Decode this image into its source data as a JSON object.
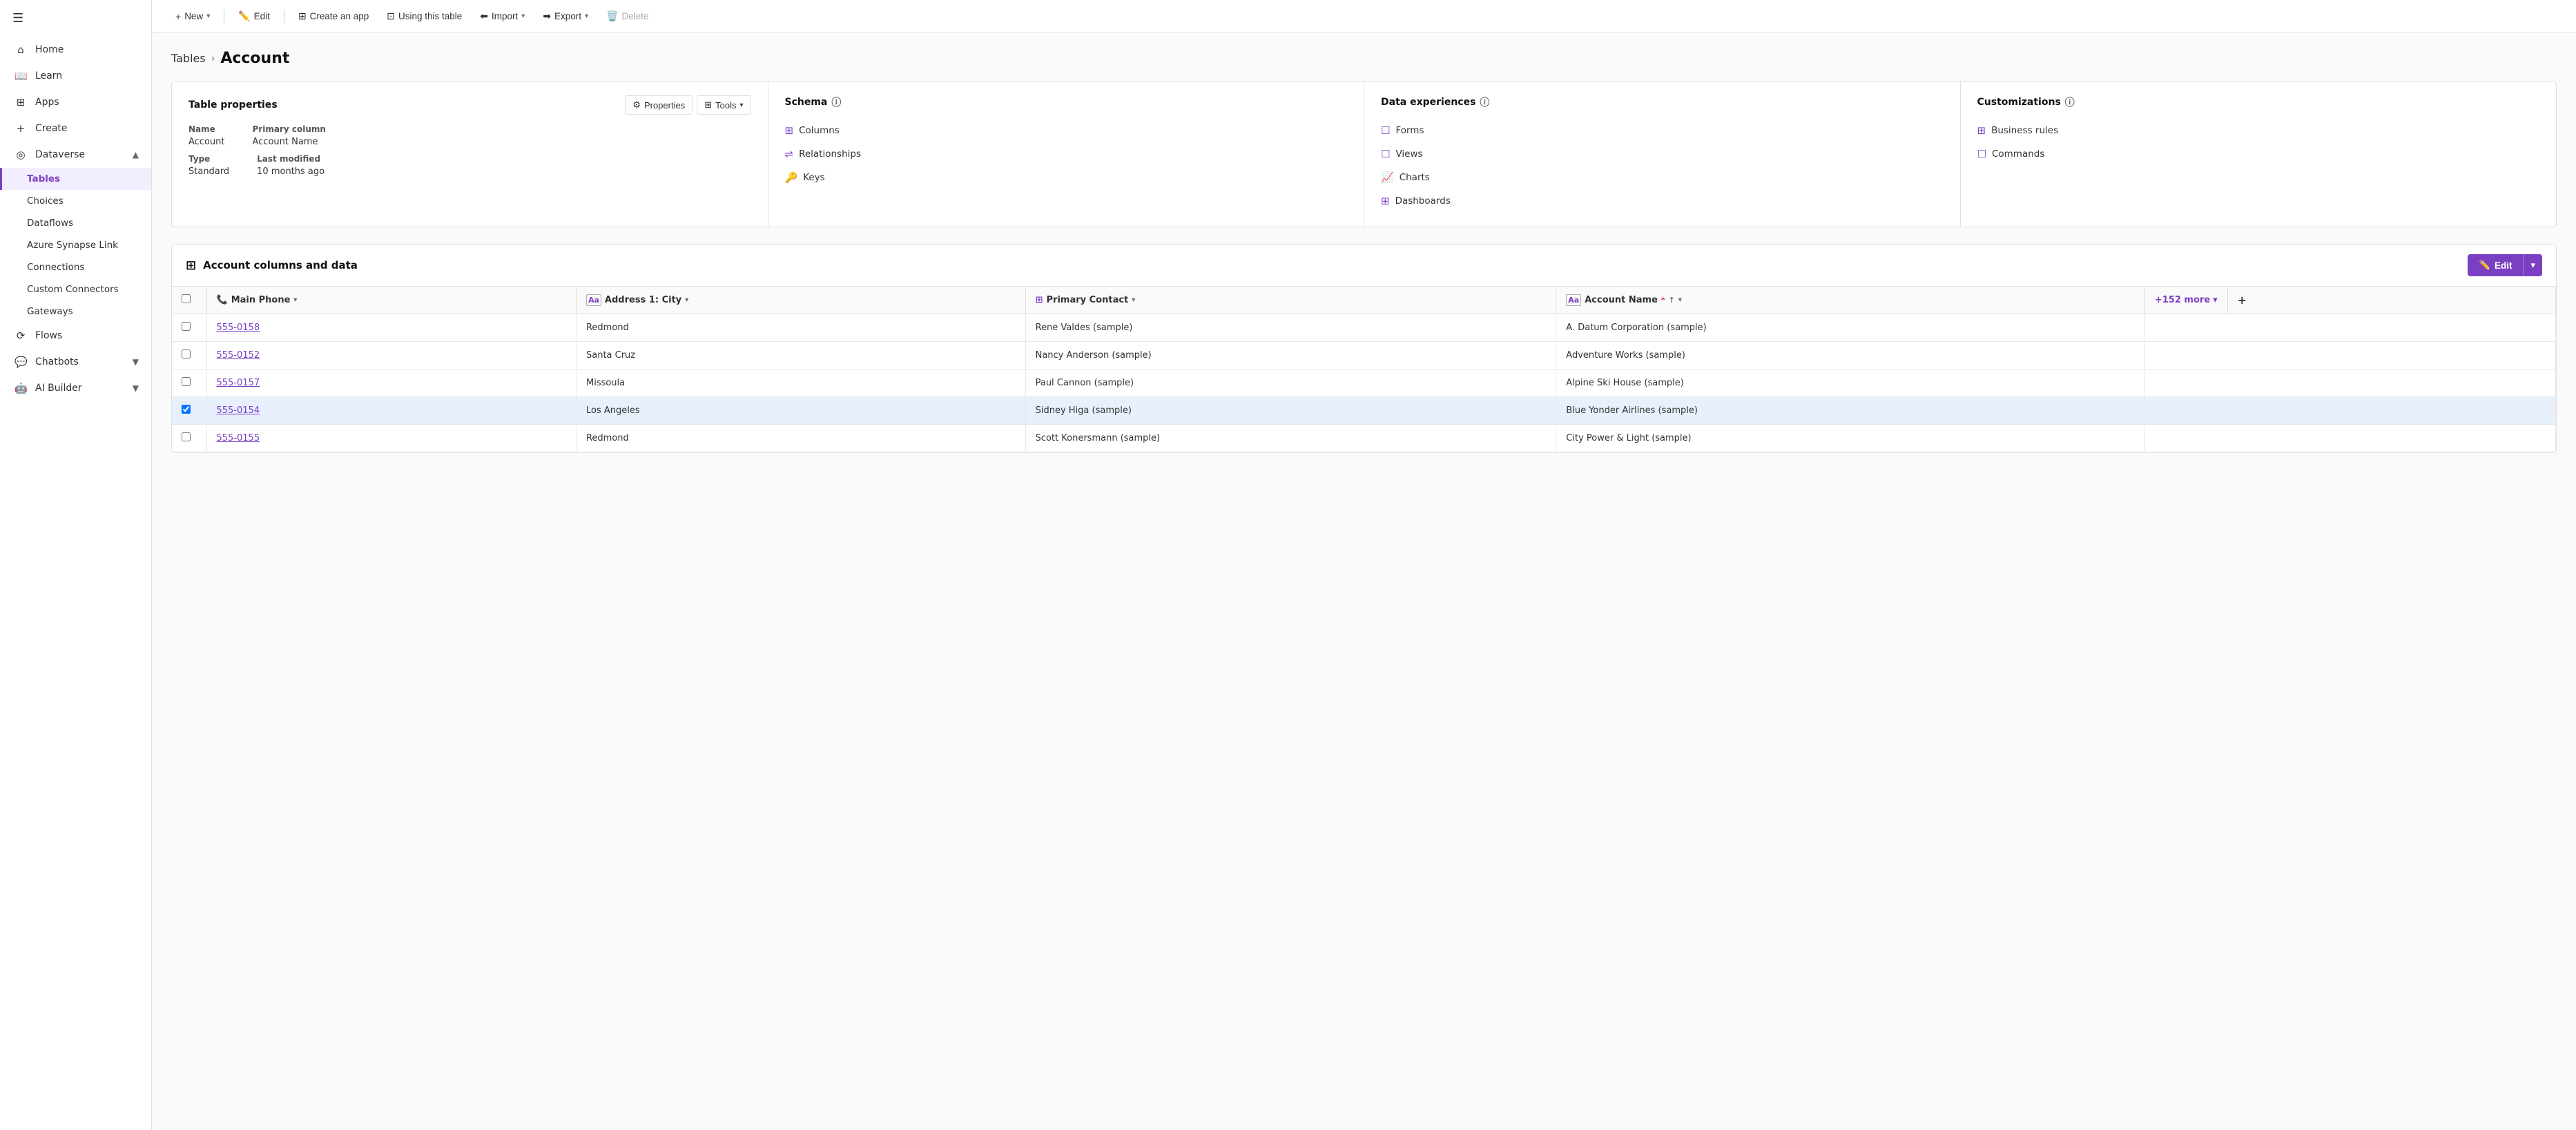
{
  "sidebar": {
    "hamburger_icon": "☰",
    "items": [
      {
        "id": "home",
        "label": "Home",
        "icon": "⌂",
        "active": false
      },
      {
        "id": "learn",
        "label": "Learn",
        "icon": "☰",
        "active": false
      },
      {
        "id": "apps",
        "label": "Apps",
        "icon": "⊞",
        "active": false
      },
      {
        "id": "create",
        "label": "Create",
        "icon": "+",
        "active": false
      },
      {
        "id": "dataverse",
        "label": "Dataverse",
        "icon": "◎",
        "active": false,
        "expanded": true,
        "has_chevron": true
      },
      {
        "id": "tables",
        "label": "Tables",
        "active": true
      },
      {
        "id": "choices",
        "label": "Choices",
        "active": false
      },
      {
        "id": "dataflows",
        "label": "Dataflows",
        "active": false
      },
      {
        "id": "azure-synapse",
        "label": "Azure Synapse Link",
        "active": false
      },
      {
        "id": "connections",
        "label": "Connections",
        "active": false
      },
      {
        "id": "custom-connectors",
        "label": "Custom Connectors",
        "active": false
      },
      {
        "id": "gateways",
        "label": "Gateways",
        "active": false
      },
      {
        "id": "flows",
        "label": "Flows",
        "icon": "⟳",
        "active": false
      },
      {
        "id": "chatbots",
        "label": "Chatbots",
        "icon": "💬",
        "active": false,
        "has_chevron": true
      },
      {
        "id": "ai-builder",
        "label": "AI Builder",
        "active": false,
        "has_chevron": true
      }
    ]
  },
  "toolbar": {
    "new_label": "New",
    "edit_label": "Edit",
    "create_app_label": "Create an app",
    "using_this_table_label": "Using this table",
    "import_label": "Import",
    "export_label": "Export",
    "delete_label": "Delete"
  },
  "breadcrumb": {
    "tables_label": "Tables",
    "separator": "›",
    "current": "Account"
  },
  "table_properties": {
    "section_title": "Table properties",
    "properties_btn": "Properties",
    "tools_btn": "Tools",
    "name_label": "Name",
    "name_value": "Account",
    "primary_col_label": "Primary column",
    "primary_col_value": "Account Name",
    "type_label": "Type",
    "type_value": "Standard",
    "last_modified_label": "Last modified",
    "last_modified_value": "10 months ago"
  },
  "schema": {
    "title": "Schema",
    "info_icon": "ⓘ",
    "links": [
      {
        "id": "columns",
        "label": "Columns",
        "icon": "⊞"
      },
      {
        "id": "relationships",
        "label": "Relationships",
        "icon": "⇌"
      },
      {
        "id": "keys",
        "label": "Keys",
        "icon": "🔑"
      }
    ]
  },
  "data_experiences": {
    "title": "Data experiences",
    "info_icon": "ⓘ",
    "links": [
      {
        "id": "forms",
        "label": "Forms",
        "icon": "☐"
      },
      {
        "id": "views",
        "label": "Views",
        "icon": "☐"
      },
      {
        "id": "charts",
        "label": "Charts",
        "icon": "📈"
      },
      {
        "id": "dashboards",
        "label": "Dashboards",
        "icon": "⊞"
      }
    ]
  },
  "customizations": {
    "title": "Customizations",
    "info_icon": "ⓘ",
    "links": [
      {
        "id": "business-rules",
        "label": "Business rules",
        "icon": "⊞"
      },
      {
        "id": "commands",
        "label": "Commands",
        "icon": "☐"
      }
    ]
  },
  "data_section": {
    "title": "Account columns and data",
    "edit_label": "Edit",
    "columns": [
      {
        "id": "checkbox",
        "label": ""
      },
      {
        "id": "main-phone",
        "label": "Main Phone",
        "icon": "📞",
        "has_dropdown": true
      },
      {
        "id": "address-city",
        "label": "Address 1: City",
        "icon": "Aa",
        "has_dropdown": true
      },
      {
        "id": "primary-contact",
        "label": "Primary Contact",
        "icon": "⊞",
        "has_dropdown": true
      },
      {
        "id": "account-name",
        "label": "Account Name",
        "icon": "Aa",
        "required": true,
        "has_sort": true,
        "has_dropdown": true
      }
    ],
    "more_cols_label": "+152 more",
    "rows": [
      {
        "id": "row1",
        "main_phone": "555-0158",
        "address_city": "Redmond",
        "primary_contact": "Rene Valdes (sample)",
        "account_name": "A. Datum Corporation (sample)",
        "selected": false,
        "phone_link": true
      },
      {
        "id": "row2",
        "main_phone": "555-0152",
        "address_city": "Santa Cruz",
        "primary_contact": "Nancy Anderson (sample)",
        "account_name": "Adventure Works (sample)",
        "selected": false,
        "phone_link": true
      },
      {
        "id": "row3",
        "main_phone": "555-0157",
        "address_city": "Missoula",
        "primary_contact": "Paul Cannon (sample)",
        "account_name": "Alpine Ski House (sample)",
        "selected": false,
        "phone_link": true,
        "underline_phone": true
      },
      {
        "id": "row4",
        "main_phone": "555-0154",
        "address_city": "Los Angeles",
        "primary_contact": "Sidney Higa (sample)",
        "account_name": "Blue Yonder Airlines (sample)",
        "selected": true,
        "phone_link": true
      },
      {
        "id": "row5",
        "main_phone": "555-0155",
        "address_city": "Redmond",
        "primary_contact": "Scott Konersmann (sample)",
        "account_name": "City Power & Light (sample)",
        "selected": false,
        "phone_link": true
      }
    ]
  },
  "colors": {
    "purple_primary": "#7b3fc4",
    "purple_light": "#f3eeff",
    "border": "#e0e0e0"
  }
}
